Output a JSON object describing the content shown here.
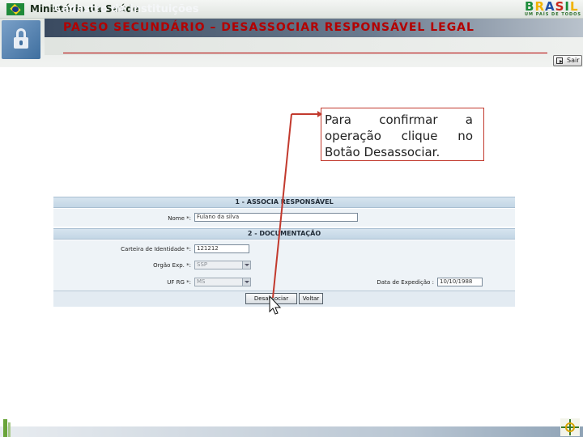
{
  "topbar": {
    "ministry": "Ministério da Saúde",
    "brand_logo": "BRASIL",
    "brand_tagline": "UM PAÍS DE TODOS"
  },
  "header": {
    "app_title": "Cadastro de Instituições",
    "page_title": "PASSO SECUNDÁRIO – DESASSOCIAR RESPONSÁVEL LEGAL",
    "exit_label": "Sair"
  },
  "callout": {
    "text": "Para confirmar a operação clique no Botão Desassociar."
  },
  "form": {
    "section1_title": "1 - ASSOCIA RESPONSÁVEL",
    "section2_title": "2 - DOCUMENTAÇÃO",
    "nome_label": "Nome *:",
    "nome_value": "Fulano da silva",
    "identidade_label": "Carteira de Identidade *:",
    "identidade_value": "121212",
    "orgao_label": "Orgão Exp. *:",
    "orgao_value": "SSP",
    "uf_label": "UF RG *:",
    "uf_value": "MS",
    "data_label": "Data de Expedição :",
    "data_value": "10/10/1988",
    "btn_desassociar": "Desassociar",
    "btn_voltar": "Voltar"
  },
  "colors": {
    "title_red": "#b40000",
    "section_blue": "#c3d6e5",
    "pointer_red": "#c23a2e"
  },
  "icons": [
    "brazil-flag-icon",
    "lock-icon",
    "exit-door-icon",
    "mouse-cursor-icon",
    "target-icon"
  ]
}
